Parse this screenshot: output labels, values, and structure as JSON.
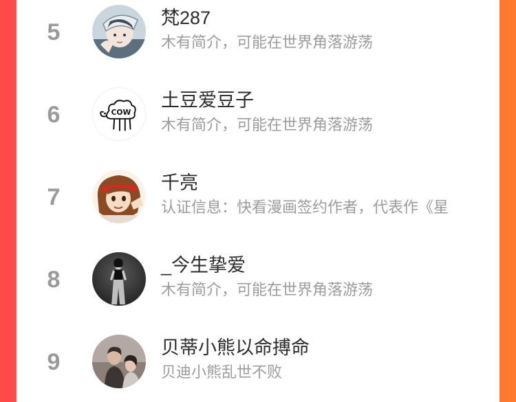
{
  "ranking": {
    "items": [
      {
        "rank": "5",
        "name": "梵287",
        "bio": "木有简介，可能在世界角落游荡",
        "avatar": "anime-boy-avatar"
      },
      {
        "rank": "6",
        "name": "土豆爱豆子",
        "bio": "木有简介，可能在世界角落游荡",
        "avatar": "cow-doodle-avatar"
      },
      {
        "rank": "7",
        "name": "千亮",
        "bio": "认证信息：快看漫画签约作者，代表作《星",
        "avatar": "anime-girl-headband-avatar"
      },
      {
        "rank": "8",
        "name": "_今生挚爱",
        "bio": "木有简介，可能在世界角落游荡",
        "avatar": "bw-photo-woman-avatar"
      },
      {
        "rank": "9",
        "name": "贝蒂小熊以命搏命",
        "bio": "贝迪小熊乱世不败",
        "avatar": "photo-couple-avatar"
      }
    ]
  },
  "colors": {
    "background_left": "#ff4a4a",
    "background_right": "#ff7a2e",
    "rank_number": "#9a9a9a",
    "name_text": "#2b2b2b",
    "bio_text": "#9b9b9b"
  }
}
